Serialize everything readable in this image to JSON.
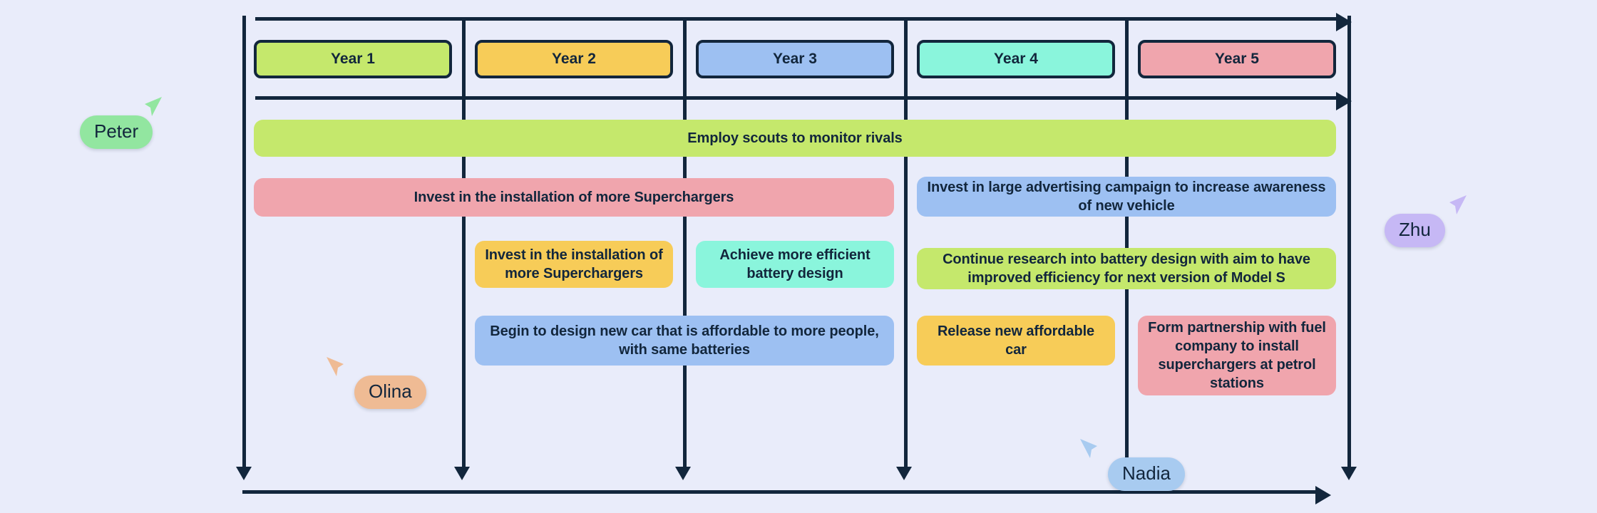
{
  "canvas": {
    "background_color": "#e9ecfa",
    "line_color": "#12263c"
  },
  "timeline": {
    "title": "",
    "columns": [
      {
        "label": "Year 1",
        "color": "#c5e86c"
      },
      {
        "label": "Year 2",
        "color": "#f7cc58"
      },
      {
        "label": "Year 3",
        "color": "#9dc0f2"
      },
      {
        "label": "Year 4",
        "color": "#8af5dc"
      },
      {
        "label": "Year 5",
        "color": "#f0a5ad"
      }
    ]
  },
  "tasks": [
    {
      "label": "Employ scouts to monitor rivals",
      "color": "#c5e86c",
      "start_year": 1,
      "end_year": 5,
      "row": 1
    },
    {
      "label": "Invest in the installation of more Superchargers",
      "color": "#f0a5ad",
      "start_year": 1,
      "end_year": 3,
      "row": 2
    },
    {
      "label": "Invest in large advertising campaign to increase awareness of new vehicle",
      "color": "#9dc0f2",
      "start_year": 4,
      "end_year": 5,
      "row": 2
    },
    {
      "label": "Invest in the installation of more Superchargers",
      "color": "#f7cc58",
      "start_year": 2,
      "end_year": 2,
      "row": 3
    },
    {
      "label": "Achieve more efficient battery design",
      "color": "#8af5dc",
      "start_year": 3,
      "end_year": 3,
      "row": 3
    },
    {
      "label": "Continue research into battery design with aim to have improved efficiency for next version of Model S",
      "color": "#c5e86c",
      "start_year": 4,
      "end_year": 5,
      "row": 3
    },
    {
      "label": "Begin to design new car that is affordable to more people, with same batteries",
      "color": "#9dc0f2",
      "start_year": 2,
      "end_year": 3,
      "row": 4
    },
    {
      "label": "Release new affordable car",
      "color": "#f7cc58",
      "start_year": 4,
      "end_year": 4,
      "row": 4
    },
    {
      "label": "Form partnership with fuel company to install superchargers at petrol stations",
      "color": "#f0a5ad",
      "start_year": 5,
      "end_year": 5,
      "row": 4
    }
  ],
  "collaborators": [
    {
      "name": "Peter",
      "pill_color": "#92e6a0",
      "arrow_color": "#92e6a0",
      "arrow_dir": "up-right"
    },
    {
      "name": "Olina",
      "pill_color": "#efbb94",
      "arrow_color": "#efbb94",
      "arrow_dir": "up-left"
    },
    {
      "name": "Nadia",
      "pill_color": "#a8cbf0",
      "arrow_color": "#a8cbf0",
      "arrow_dir": "up-left"
    },
    {
      "name": "Zhu",
      "pill_color": "#c6b8f5",
      "arrow_color": "#c6b8f5",
      "arrow_dir": "up-right"
    }
  ]
}
